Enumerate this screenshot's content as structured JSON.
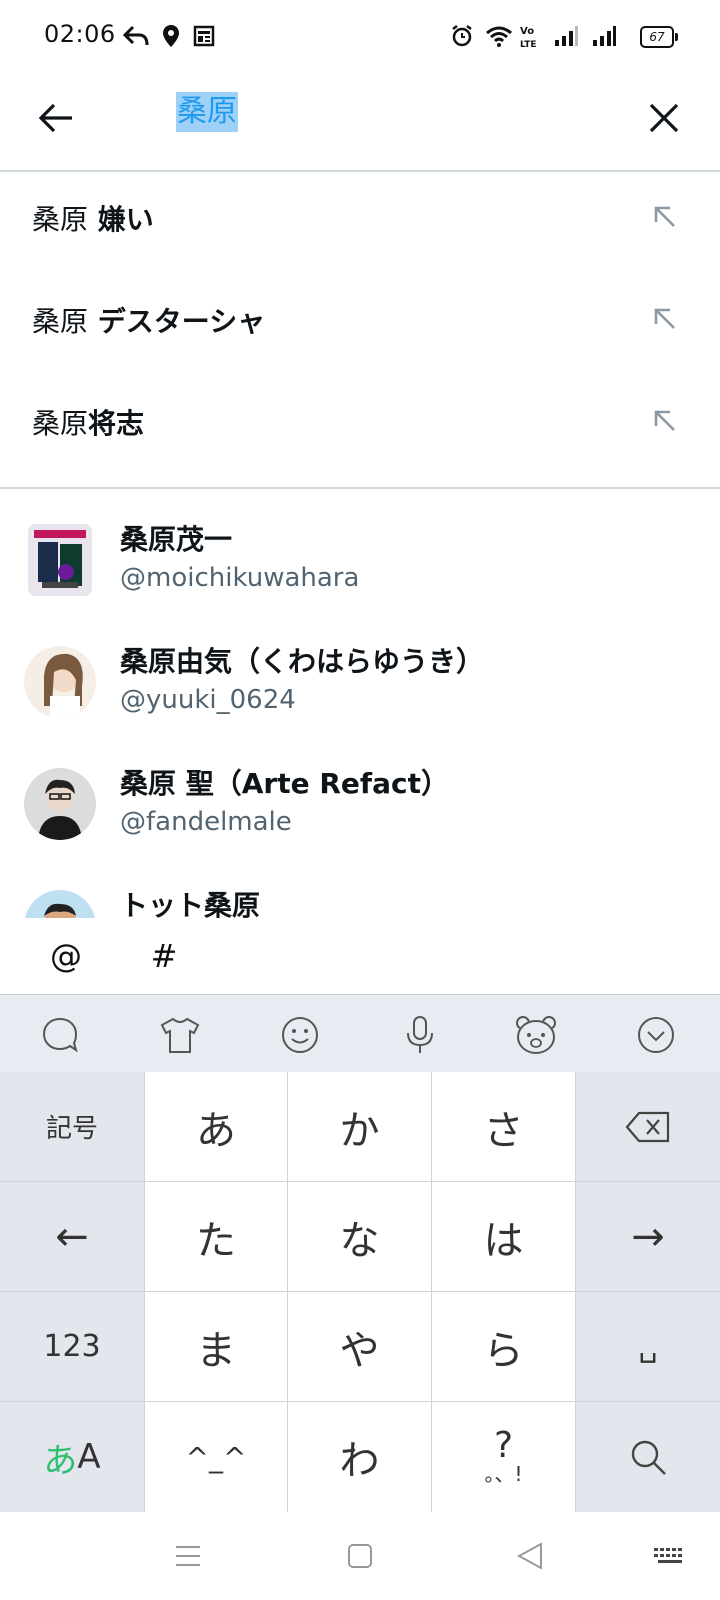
{
  "status_bar": {
    "time": "02:06",
    "battery": "67"
  },
  "search": {
    "query": "桑原"
  },
  "suggestions": [
    {
      "query": "桑原",
      "completion": " 嫌い"
    },
    {
      "query": "桑原",
      "completion": " デスターシャ"
    },
    {
      "query": "桑原",
      "completion": "将志"
    }
  ],
  "users": [
    {
      "name": "桑原茂一",
      "handle": "@moichikuwahara"
    },
    {
      "name": "桑原由気（くわはらゆうき）",
      "handle": "@yuuki_0624"
    },
    {
      "name": "桑原 聖（Arte Refact）",
      "handle": "@fandelmale"
    },
    {
      "name": "トット桑原",
      "handle": ""
    }
  ],
  "mention_bar": {
    "at": "@",
    "hash": "#"
  },
  "keyboard": {
    "left_col": [
      "記号",
      "←",
      "123"
    ],
    "mode_key": {
      "kana": "あ",
      "latin": "A"
    },
    "rows": [
      [
        "あ",
        "か",
        "さ"
      ],
      [
        "た",
        "な",
        "は"
      ],
      [
        "ま",
        "や",
        "ら"
      ],
      [
        "^_^",
        "わ",
        "?"
      ]
    ],
    "punct_sub": "。、!",
    "right_col": [
      "→",
      "␣"
    ],
    "accent_color": "#2fbf71"
  },
  "colors": {
    "accent": "#1d9bf0",
    "selection": "#9fd0f7",
    "handle": "#536471"
  }
}
